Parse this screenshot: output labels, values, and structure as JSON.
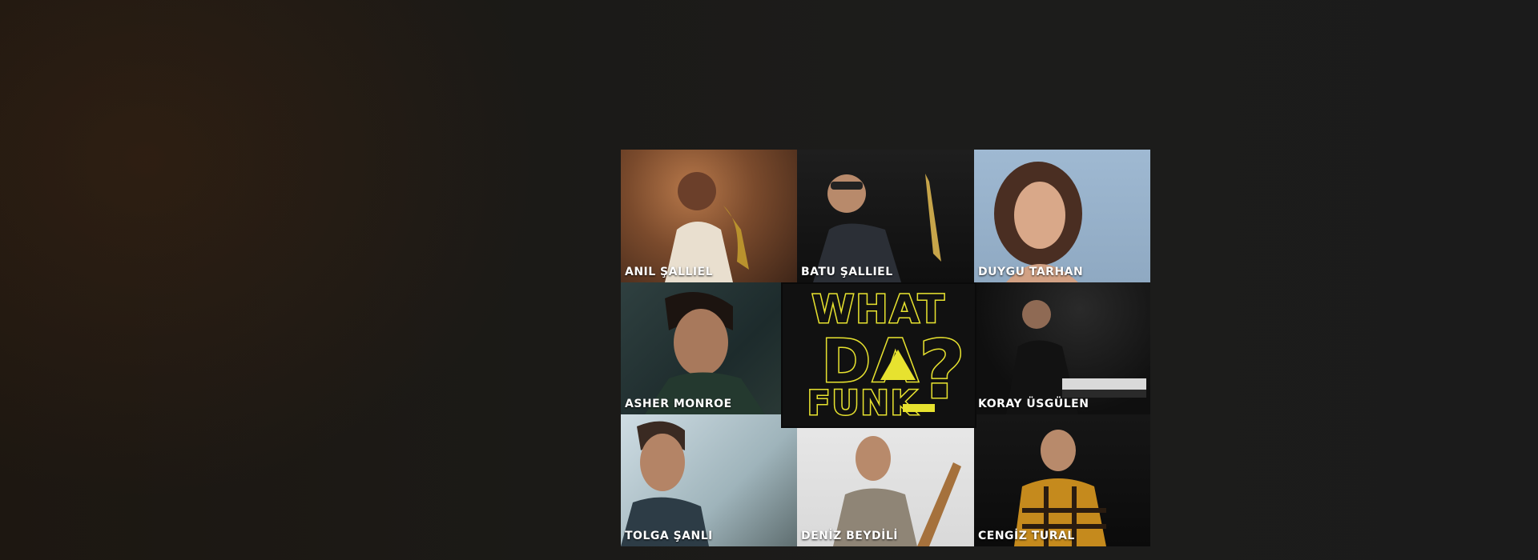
{
  "artists": [
    {
      "name": "ANIL ŞALLIEL"
    },
    {
      "name": "BATU ŞALLIEL"
    },
    {
      "name": "DUYGU TARHAN"
    },
    {
      "name": "ASHER MONROE"
    },
    {
      "name": "KORAY ÜSGÜLEN"
    },
    {
      "name": "TOLGA ŞANLI"
    },
    {
      "name": "DENİZ BEYDİLİ"
    },
    {
      "name": "CENGİZ TURAL"
    }
  ],
  "logo": {
    "line1": "WHAT",
    "line2": "DA",
    "line3": "FUNK",
    "mark": "?"
  },
  "colors": {
    "accent": "#e7e22f",
    "background": "#1b1a18"
  }
}
